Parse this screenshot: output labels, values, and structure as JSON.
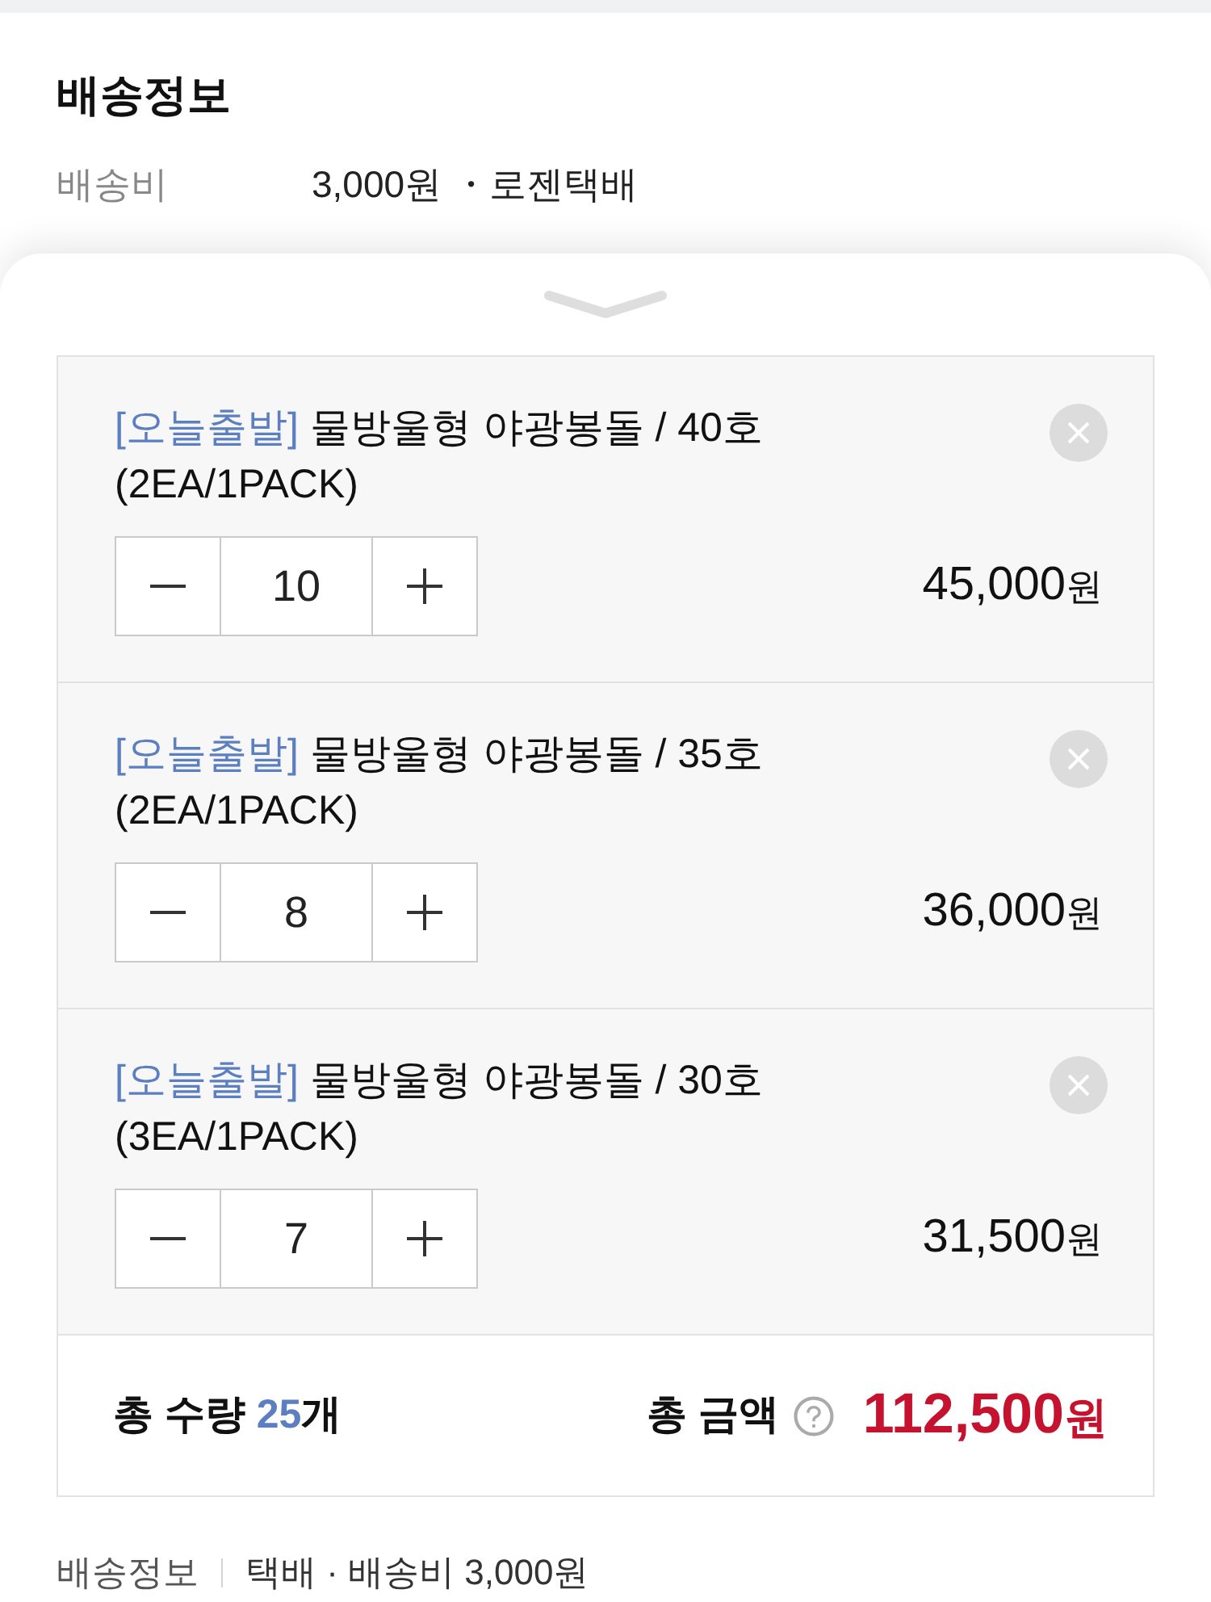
{
  "header": {
    "title": "배송정보",
    "rows": [
      {
        "label": "배송비",
        "value": "3,000원 ・로젠택배"
      }
    ]
  },
  "items": [
    {
      "tag": "[오늘출발]",
      "name": "물방울형 야광봉돌 / 40호",
      "option": "(2EA/1PACK)",
      "quantity": "10",
      "price": "45,000",
      "currency": "원"
    },
    {
      "tag": "[오늘출발]",
      "name": "물방울형 야광봉돌 / 35호",
      "option": "(2EA/1PACK)",
      "quantity": "8",
      "price": "36,000",
      "currency": "원"
    },
    {
      "tag": "[오늘출발]",
      "name": "물방울형 야광봉돌 / 30호",
      "option": "(3EA/1PACK)",
      "quantity": "7",
      "price": "31,500",
      "currency": "원"
    }
  ],
  "summary": {
    "quantity_label": "총 수량",
    "quantity": "25",
    "quantity_unit": "개",
    "amount_label": "총 금액",
    "amount": "112,500",
    "currency": "원"
  },
  "footer": {
    "label": "배송정보",
    "value": "택배 · 배송비 3,000원"
  }
}
